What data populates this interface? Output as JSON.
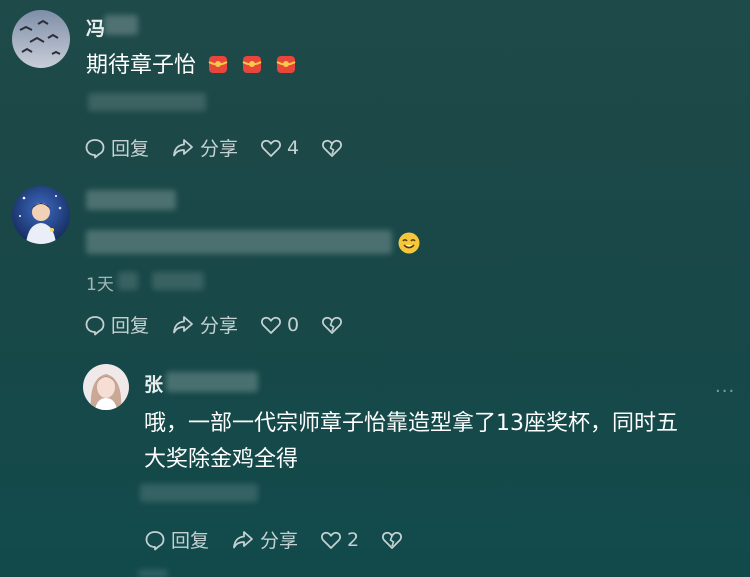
{
  "comments": [
    {
      "username": "冯",
      "text": "期待章子怡",
      "emoji_icon": "red-envelope-emoji",
      "actions": {
        "reply": "回复",
        "share": "分享",
        "likes": "4"
      }
    },
    {
      "username": "",
      "text": "",
      "emoji_icon": "smile-emoji",
      "time": "1天",
      "actions": {
        "reply": "回复",
        "share": "分享",
        "likes": "0"
      }
    }
  ],
  "reply": {
    "username": "张",
    "text_line1": "哦，一部一代宗师章子怡靠造型拿了13座奖杯，同时五",
    "text_line2": "大奖除金鸡全得",
    "more": "...",
    "actions": {
      "reply": "回复",
      "share": "分享",
      "likes": "2"
    }
  },
  "colors": {
    "background_top": "#1f4a4a",
    "background_bottom": "#124a4c",
    "text": "#ffffff"
  }
}
